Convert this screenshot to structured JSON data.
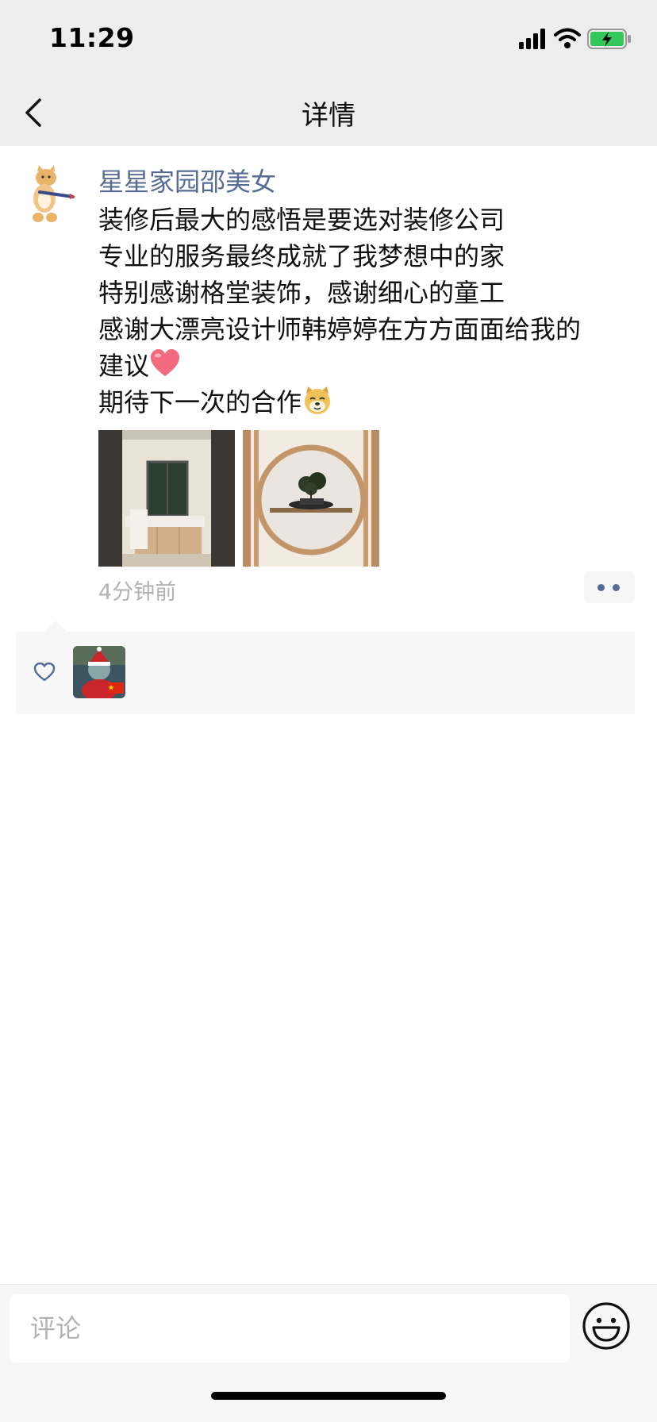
{
  "status_bar": {
    "time": "11:29"
  },
  "nav": {
    "title": "详情"
  },
  "post": {
    "author": "星星家园邵美女",
    "lines": [
      "装修后最大的感悟是要选对装修公司",
      "专业的服务最终成就了我梦想中的家",
      "特别感谢格堂装饰，感谢细心的童工",
      "感谢大漂亮设计师韩婷婷在方方面面给我的",
      "建议",
      "期待下一次的合作"
    ],
    "emoji_after_line_5": "heart-emoji",
    "emoji_after_line_6": "doge-emoji",
    "time_ago": "4分钟前"
  },
  "comment_bar": {
    "placeholder": "评论"
  },
  "colors": {
    "link": "#576b95",
    "bar_bg": "#ededed",
    "panel_bg": "#f7f7f7",
    "muted": "#b2b2b2"
  }
}
